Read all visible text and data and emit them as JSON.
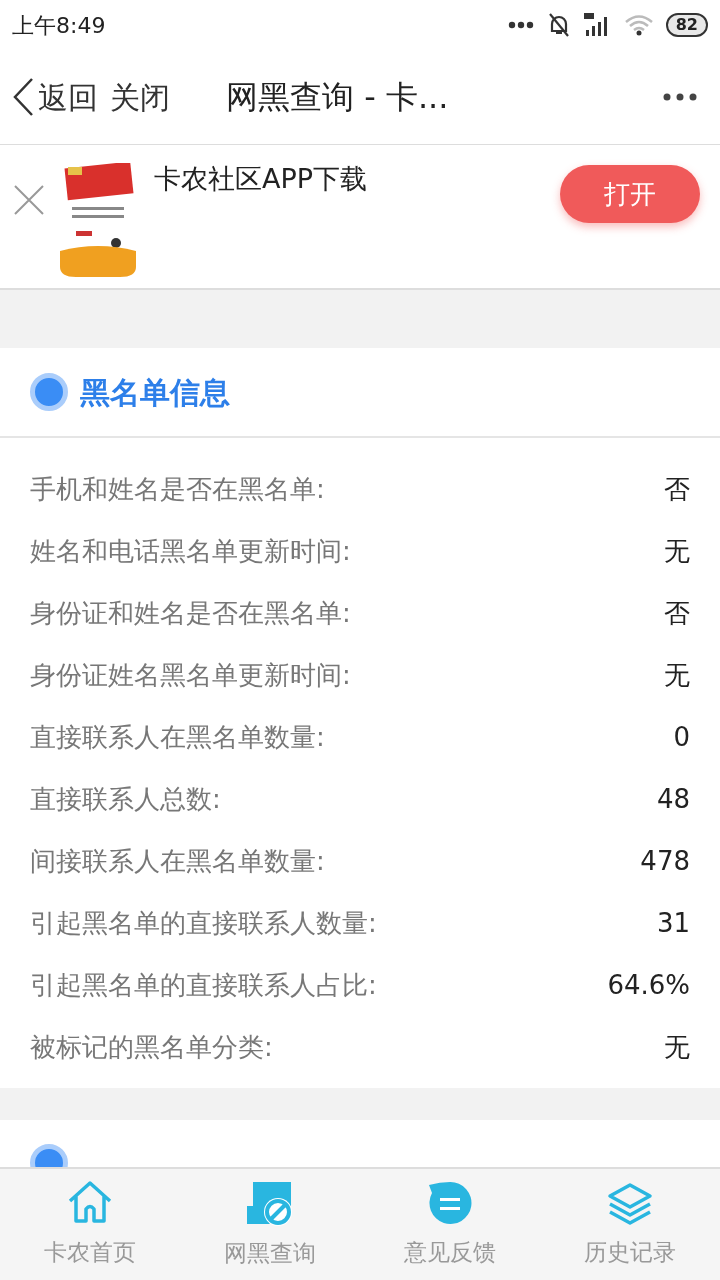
{
  "status_bar": {
    "time": "上午8:49",
    "battery": "82"
  },
  "nav": {
    "back": "返回",
    "close": "关闭",
    "title": "网黑查询 - 卡..."
  },
  "ad": {
    "title": "卡农社区APP下载",
    "button": "打开"
  },
  "section": {
    "title": "黑名单信息",
    "rows": [
      {
        "label": "手机和姓名是否在黑名单:",
        "value": "否"
      },
      {
        "label": "姓名和电话黑名单更新时间:",
        "value": "无"
      },
      {
        "label": "身份证和姓名是否在黑名单:",
        "value": "否"
      },
      {
        "label": "身份证姓名黑名单更新时间:",
        "value": "无"
      },
      {
        "label": "直接联系人在黑名单数量:",
        "value": "0"
      },
      {
        "label": "直接联系人总数:",
        "value": "48"
      },
      {
        "label": "间接联系人在黑名单数量:",
        "value": "478"
      },
      {
        "label": "引起黑名单的直接联系人数量:",
        "value": "31"
      },
      {
        "label": "引起黑名单的直接联系人占比:",
        "value": "64.6%"
      },
      {
        "label": "被标记的黑名单分类:",
        "value": "无"
      }
    ]
  },
  "tab_bar": [
    {
      "kind": "home",
      "label": "卡农首页"
    },
    {
      "kind": "blacklist",
      "label": "网黑查询"
    },
    {
      "kind": "feedback",
      "label": "意见反馈"
    },
    {
      "kind": "history",
      "label": "历史记录"
    }
  ]
}
